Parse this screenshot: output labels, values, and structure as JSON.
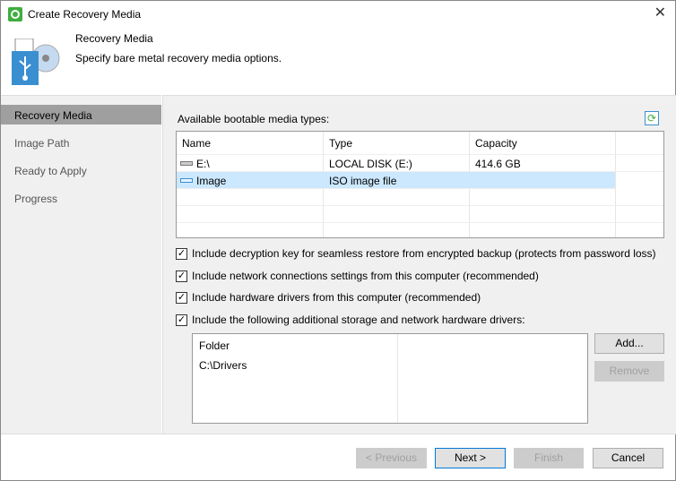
{
  "window": {
    "title": "Create Recovery Media"
  },
  "header": {
    "title": "Recovery Media",
    "subtitle": "Specify bare metal recovery media options."
  },
  "sidebar": {
    "items": [
      {
        "label": "Recovery Media"
      },
      {
        "label": "Image Path"
      },
      {
        "label": "Ready to Apply"
      },
      {
        "label": "Progress"
      }
    ]
  },
  "media": {
    "label": "Available bootable media types:",
    "columns": [
      "Name",
      "Type",
      "Capacity"
    ],
    "rows": [
      {
        "name": "E:\\",
        "type": "LOCAL DISK (E:)",
        "capacity": "414.6 GB"
      },
      {
        "name": "Image",
        "type": "ISO image file",
        "capacity": ""
      }
    ]
  },
  "options": [
    {
      "label": "Include decryption key for seamless restore from encrypted backup (protects from password loss)",
      "checked": true
    },
    {
      "label": "Include network connections settings from this computer (recommended)",
      "checked": true
    },
    {
      "label": "Include hardware drivers from this computer (recommended)",
      "checked": true
    },
    {
      "label": "Include the following additional storage and network hardware drivers:",
      "checked": true
    }
  ],
  "drivers": {
    "column": "Folder",
    "rows": [
      "C:\\Drivers"
    ],
    "add": "Add...",
    "remove": "Remove"
  },
  "footer": {
    "previous": "< Previous",
    "next": "Next >",
    "finish": "Finish",
    "cancel": "Cancel"
  },
  "colors": {
    "selection": "#cce8ff",
    "sidebar_selected": "#9f9f9f"
  }
}
